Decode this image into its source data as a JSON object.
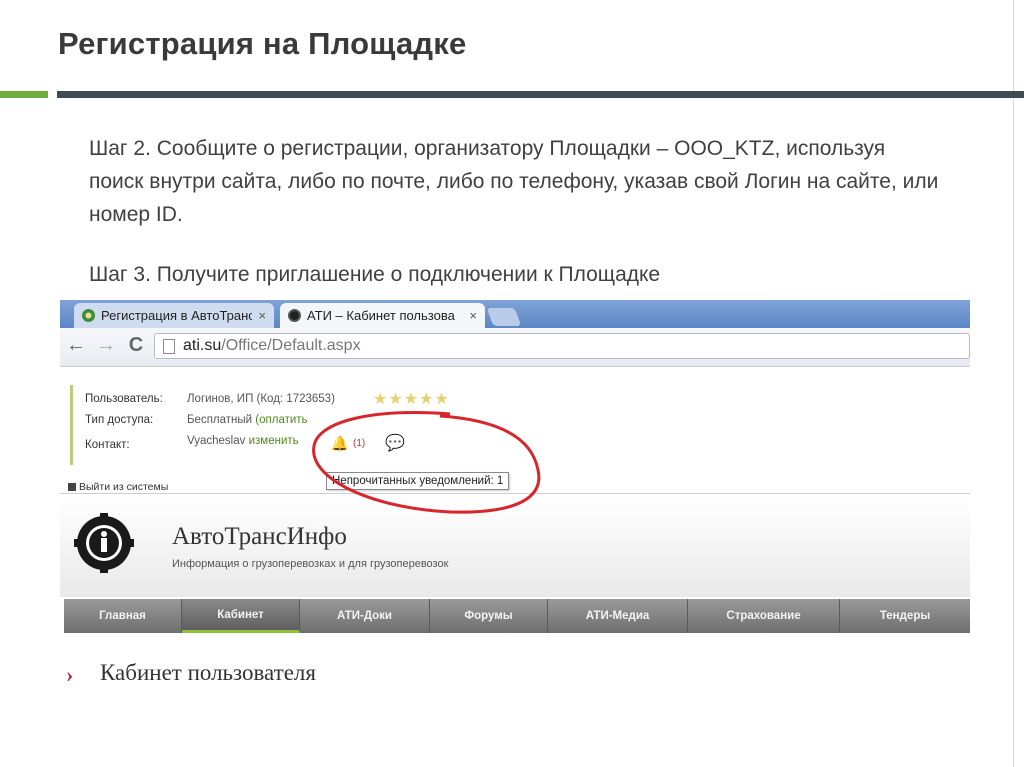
{
  "slide": {
    "title": "Регистрация на Площадке",
    "step2": "Шаг 2. Сообщите о регистрации, организатору Площадки – ООО_KTZ, используя поиск внутри сайта, либо по почте, либо по телефону, указав свой Логин на сайте, или номер ID.",
    "step3": "Шаг 3. Получите приглашение о подключении к Площадке"
  },
  "browser": {
    "tabs": [
      {
        "label": "Регистрация в АвтоТранс",
        "close": "×"
      },
      {
        "label": "АТИ – Кабинет пользова",
        "close": "×"
      }
    ],
    "url_host": "ati.su",
    "url_path": "/Office/Default.aspx",
    "back": "←",
    "forward": "→",
    "reload": "C"
  },
  "userinfo": {
    "user_label": "Пользователь:",
    "user_value": "Логинов, ИП (Код: 1723653)",
    "stars": "★★★★★",
    "access_label": "Тип доступа:",
    "access_value": "Бесплатный",
    "access_link": "(оплатить",
    "contact_label": "Контакт:",
    "contact_value": "Vyacheslav",
    "contact_link": "изменить",
    "notif_count": "(1)",
    "tooltip": "Непрочитанных уведомлений: 1",
    "logout": "Выйти из системы"
  },
  "site": {
    "brand": "АвтоТрансИнфо",
    "tagline": "Информация о грузоперевозках и для грузоперевозок",
    "nav": [
      "Главная",
      "Кабинет",
      "АТИ-Доки",
      "Форумы",
      "АТИ-Медиа",
      "Страхование",
      "Тендеры"
    ],
    "active_nav": "Кабинет",
    "section_title": "Кабинет пользователя"
  },
  "colors": {
    "accent_green": "#6fae3c",
    "title_bar": "#404a52",
    "highlight": "#d8262e"
  }
}
